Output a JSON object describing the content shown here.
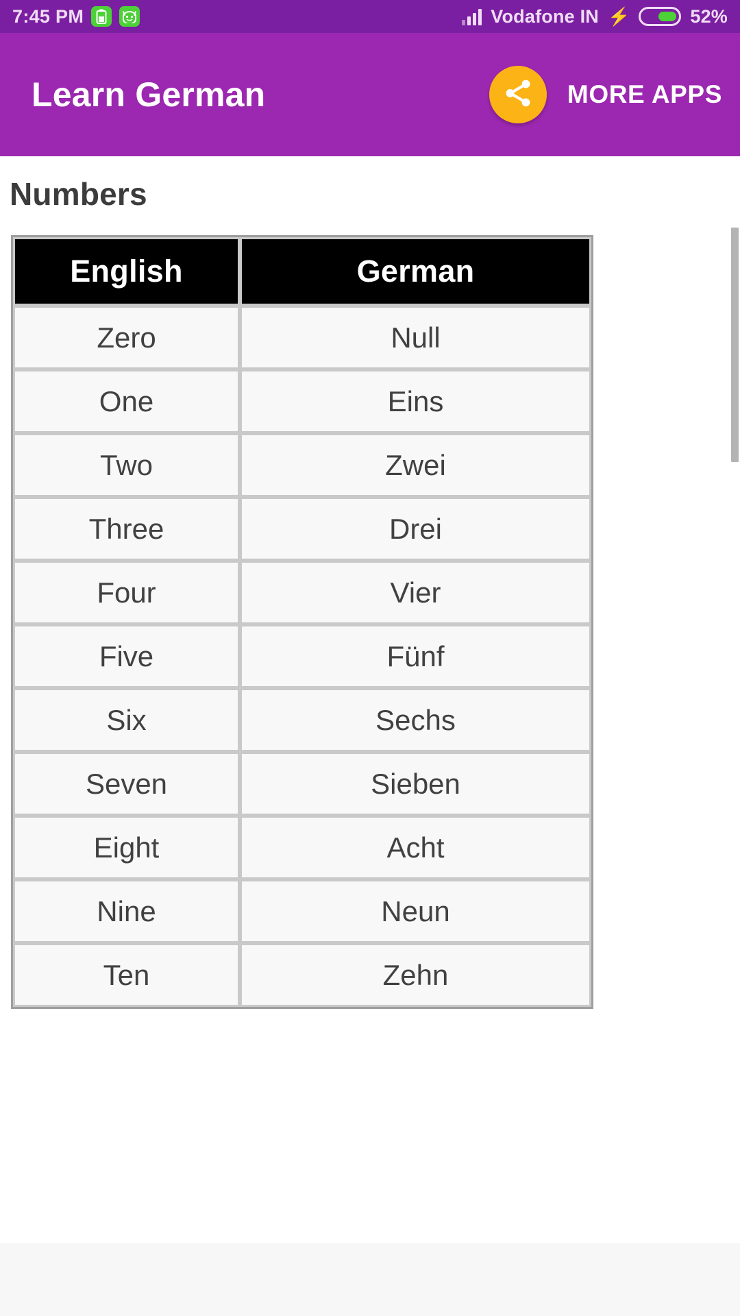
{
  "status_bar": {
    "time": "7:45 PM",
    "notification_icons": [
      "battery-saver-icon",
      "android-mascot-icon"
    ],
    "signal_icon": "signal-bars-icon",
    "carrier": "Vodafone IN",
    "charging_icon": "lightning-bolt-icon",
    "battery_icon": "battery-icon",
    "battery_percent": "52%",
    "background_color": "#7B1FA2",
    "text_color": "#F0DDF5",
    "accent_green": "#4CD137"
  },
  "app_bar": {
    "title": "Learn German",
    "share_icon": "share-icon",
    "more_apps_label": "MORE APPS",
    "background_color": "#9C27B0",
    "share_button_color": "#FCB316"
  },
  "page": {
    "section_title": "Numbers"
  },
  "table": {
    "columns": [
      "English",
      "German"
    ],
    "rows": [
      [
        "Zero",
        "Null"
      ],
      [
        "One",
        "Eins"
      ],
      [
        "Two",
        "Zwei"
      ],
      [
        "Three",
        "Drei"
      ],
      [
        "Four",
        "Vier"
      ],
      [
        "Five",
        "Fünf"
      ],
      [
        "Six",
        "Sechs"
      ],
      [
        "Seven",
        "Sieben"
      ],
      [
        "Eight",
        "Acht"
      ],
      [
        "Nine",
        "Neun"
      ],
      [
        "Ten",
        "Zehn"
      ]
    ],
    "header_background": "#000000",
    "header_text_color": "#FFFFFF",
    "cell_background": "#F8F8F8",
    "cell_text_color": "#414141",
    "border_color": "#C9C9C9"
  },
  "scrollbar": {
    "thumb_color": "#B4B4B4"
  }
}
